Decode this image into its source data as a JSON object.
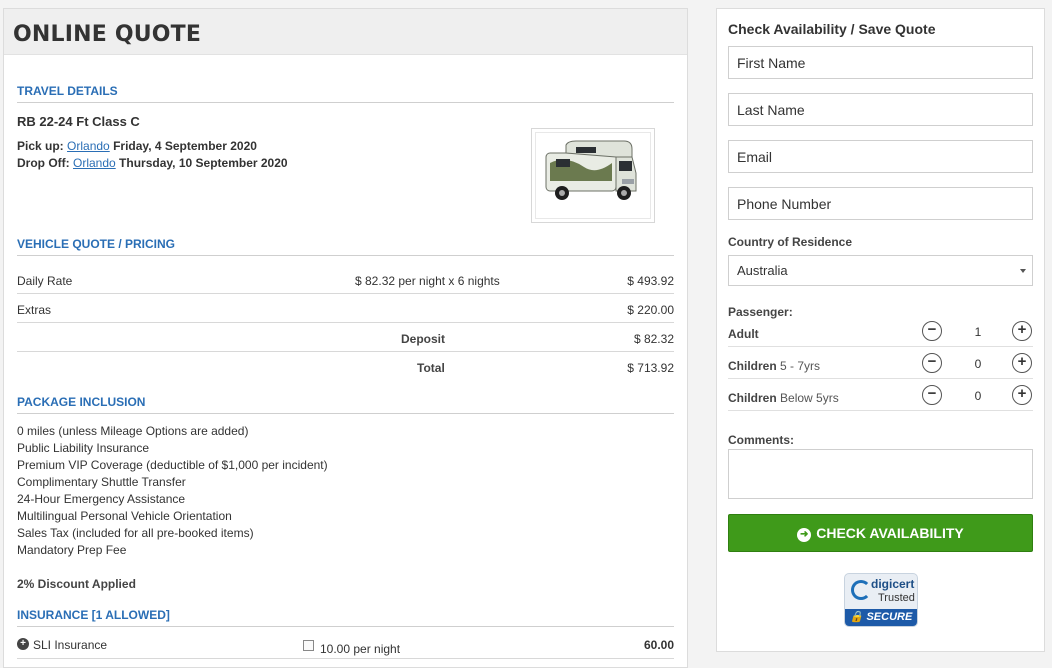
{
  "quote": {
    "title": "ONLINE QUOTE",
    "travel_section": "TRAVEL DETAILS",
    "vehicle_name": "RB 22-24 Ft Class C",
    "pickup_label": "Pick up:",
    "pickup_location": "Orlando",
    "pickup_date": "Friday, 4 September 2020",
    "dropoff_label": "Drop Off:",
    "dropoff_location": "Orlando",
    "dropoff_date": "Thursday, 10 September 2020",
    "pricing_section": "VEHICLE QUOTE / PRICING",
    "daily_rate_label": "Daily Rate",
    "daily_rate_detail": "$ 82.32 per night x 6 nights",
    "daily_rate_amount": "$ 493.92",
    "extras_label": "Extras",
    "extras_amount": "$ 220.00",
    "deposit_label": "Deposit",
    "deposit_amount": "$ 82.32",
    "total_label": "Total",
    "total_amount": "$ 713.92",
    "package_section": "PACKAGE INCLUSION",
    "inclusions": [
      "0 miles (unless Mileage Options are added)",
      "Public Liability Insurance",
      "Premium VIP Coverage (deductible of $1,000 per incident)",
      "Complimentary Shuttle Transfer",
      "24-Hour Emergency Assistance",
      "Multilingual Personal Vehicle Orientation",
      "Sales Tax (included for all pre-booked items)",
      "Mandatory Prep Fee"
    ],
    "discount": "2% Discount Applied",
    "insurance_section": "INSURANCE [1 ALLOWED]",
    "insurance_name": "SLI Insurance",
    "insurance_rate": "10.00 per night",
    "insurance_amount": "60.00"
  },
  "form": {
    "title": "Check Availability / Save Quote",
    "first_name_placeholder": "First Name",
    "last_name_placeholder": "Last Name",
    "email_placeholder": "Email",
    "phone_placeholder": "Phone Number",
    "country_label": "Country of Residence",
    "country_value": "Australia",
    "passenger_label": "Passenger:",
    "adult_label": "Adult",
    "adult_count": "1",
    "children_label": "Children",
    "children_age": "5 - 7yrs",
    "children_count": "0",
    "children_below_label": "Children",
    "children_below_age": "Below 5yrs",
    "children_below_count": "0",
    "comments_label": "Comments:",
    "button_label": "CHECK AVAILABILITY",
    "badge_brand": "digicert",
    "badge_trusted": "Trusted",
    "badge_secure": "SECURE"
  },
  "colors": {
    "accent_blue": "#2a6eb5",
    "button_green": "#3f9a1a"
  }
}
